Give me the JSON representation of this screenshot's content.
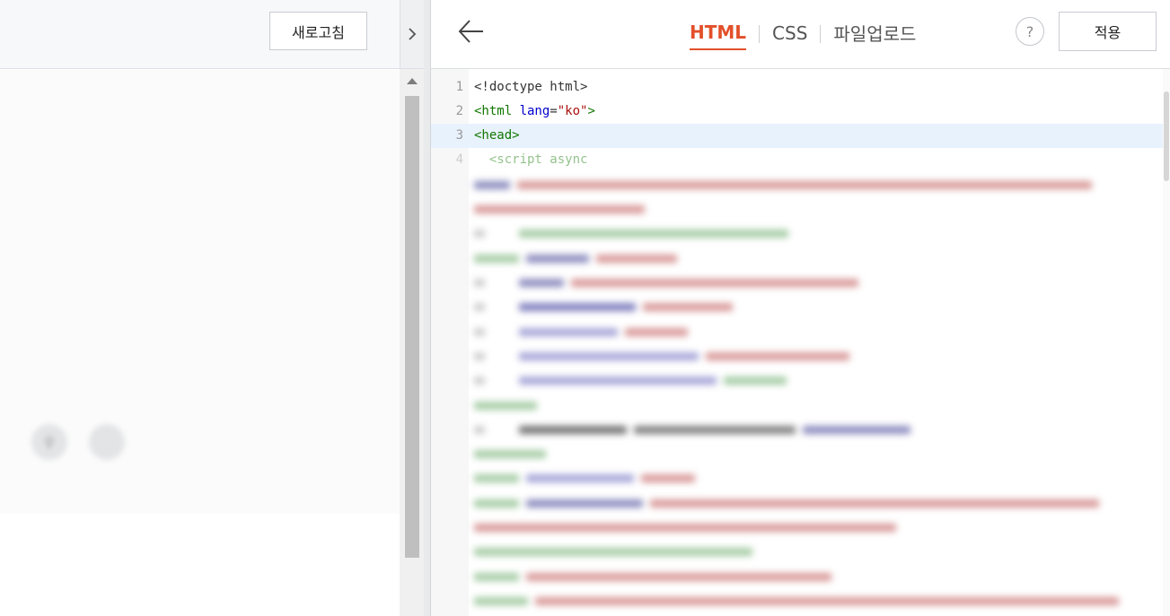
{
  "preview": {
    "refresh_label": "새로고침"
  },
  "editor": {
    "tabs": [
      {
        "label": "HTML",
        "active": true
      },
      {
        "label": "CSS",
        "active": false
      },
      {
        "label": "파일업로드",
        "active": false
      }
    ],
    "help_label": "?",
    "apply_label": "적용"
  },
  "code": {
    "lines": [
      {
        "num": "1",
        "text": "<!doctype html>"
      },
      {
        "num": "2",
        "tag_open": "<html ",
        "attr": "lang",
        "eq": "=",
        "str": "\"ko\"",
        "tag_close": ">"
      },
      {
        "num": "3",
        "text": "<head>"
      },
      {
        "num": "4",
        "text": "  <script async"
      }
    ]
  },
  "colors": {
    "accent": "#e2502a",
    "tag": "#117700",
    "attr": "#0000cc",
    "string": "#aa1111",
    "highlight": "#e8f2fd"
  }
}
